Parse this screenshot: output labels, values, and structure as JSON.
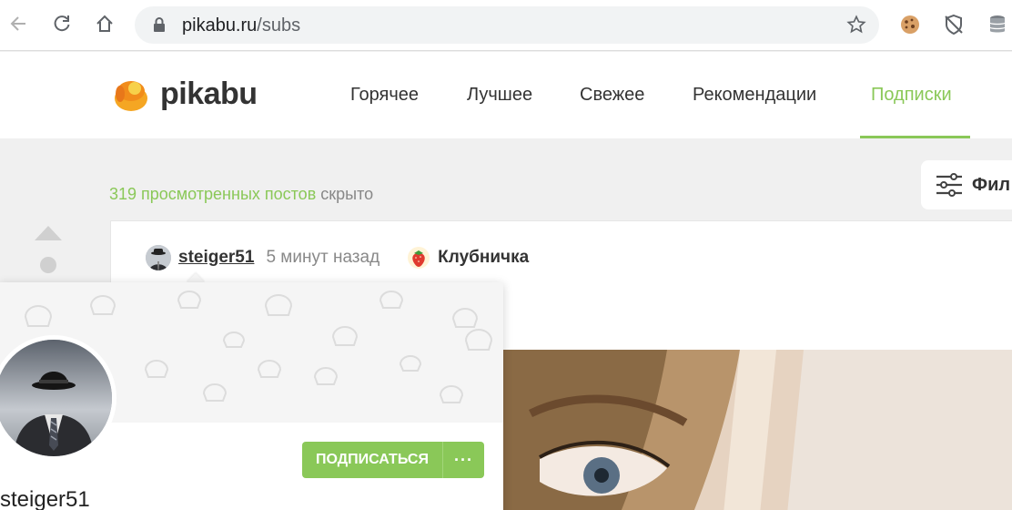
{
  "browser": {
    "url_host": "pikabu.ru",
    "url_path": "/subs",
    "icons": [
      "back-icon",
      "reload-icon",
      "home-icon",
      "lock-icon",
      "star-icon",
      "cookie-extension-icon",
      "shield-extension-icon",
      "database-extension-icon"
    ]
  },
  "site": {
    "logo_text": "pikabu",
    "nav": [
      {
        "label": "Горячее",
        "active": false
      },
      {
        "label": "Лучшее",
        "active": false
      },
      {
        "label": "Свежее",
        "active": false
      },
      {
        "label": "Рекомендации",
        "active": false
      },
      {
        "label": "Подписки",
        "active": true
      }
    ],
    "accent_color": "#8ac858"
  },
  "feed": {
    "hidden_count_text": "319 просмотренных постов",
    "hidden_suffix": "скрыто",
    "filter_label": "Фил"
  },
  "post": {
    "author": "steiger51",
    "time": "5 минут назад",
    "community": "Клубничка"
  },
  "profile_popup": {
    "subscribe_label": "ПОДПИСАТЬСЯ",
    "more_label": "···",
    "username": "steiger51"
  }
}
